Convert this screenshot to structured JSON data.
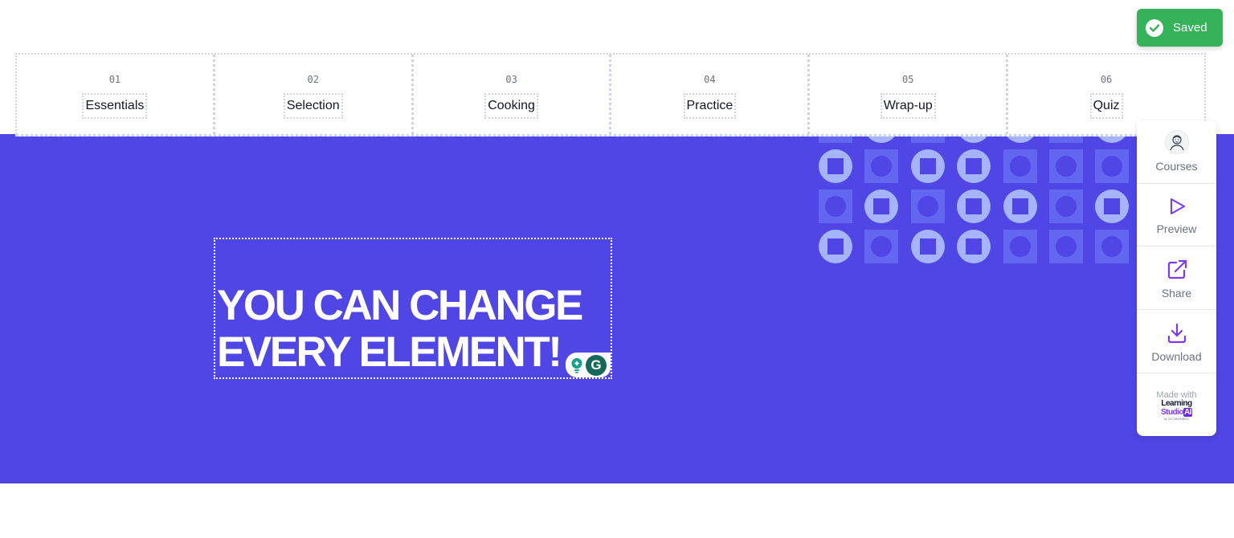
{
  "toast": {
    "label": "Saved",
    "icon": "check-circle-icon",
    "color": "#36b35a"
  },
  "nav": {
    "items": [
      {
        "number": "01",
        "label": "Essentials"
      },
      {
        "number": "02",
        "label": "Selection"
      },
      {
        "number": "03",
        "label": "Cooking"
      },
      {
        "number": "04",
        "label": "Practice"
      },
      {
        "number": "05",
        "label": "Wrap-up"
      },
      {
        "number": "06",
        "label": "Quiz"
      }
    ]
  },
  "hero": {
    "background": "#4f46e5",
    "heading_line1": "YOU CAN CHANGE",
    "heading_line2": "EVERY ELEMENT!",
    "pattern_rows": [
      [
        "square",
        "circle",
        "square",
        "circle",
        "circle",
        "square",
        "circle"
      ],
      [
        "circle",
        "square",
        "circle",
        "circle",
        "square",
        "square",
        "square"
      ],
      [
        "square",
        "circle",
        "square",
        "circle",
        "circle",
        "square",
        "circle"
      ],
      [
        "circle",
        "square",
        "circle",
        "circle",
        "square",
        "square",
        "square"
      ]
    ]
  },
  "grammarly": {
    "bulb_icon": "lightbulb-icon",
    "logo_letter": "G"
  },
  "sidebar": {
    "items": [
      {
        "label": "Courses",
        "icon": "avatar-icon"
      },
      {
        "label": "Preview",
        "icon": "play-icon"
      },
      {
        "label": "Share",
        "icon": "external-link-icon"
      },
      {
        "label": "Download",
        "icon": "download-icon"
      }
    ],
    "made_with": "Made with",
    "brand_line1": "Learning",
    "brand_line2": "Studio",
    "brand_ai": "AI",
    "brand_by": "by SCORMHERO",
    "accent": "#7c3aed"
  }
}
